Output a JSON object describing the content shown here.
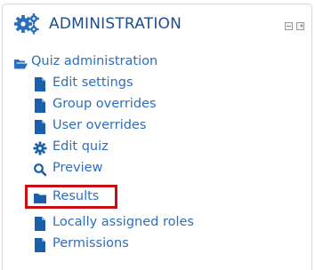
{
  "block": {
    "title": "ADMINISTRATION",
    "header_icon": "gears-icon",
    "controls": {
      "minimize_icon": "minimize-icon",
      "dock_icon": "dock-icon"
    }
  },
  "tree": {
    "root": {
      "label": "Quiz administration",
      "icon": "folder-open-icon"
    },
    "items": [
      {
        "label": "Edit settings",
        "icon": "file-icon"
      },
      {
        "label": "Group overrides",
        "icon": "file-icon"
      },
      {
        "label": "User overrides",
        "icon": "file-icon"
      },
      {
        "label": "Edit quiz",
        "icon": "gear-icon"
      },
      {
        "label": "Preview",
        "icon": "search-icon"
      },
      {
        "label": "Results",
        "icon": "folder-icon",
        "highlighted": true
      },
      {
        "label": "Locally assigned roles",
        "icon": "file-icon"
      },
      {
        "label": "Permissions",
        "icon": "file-icon"
      }
    ]
  },
  "colors": {
    "link": "#2c6fbe",
    "icon": "#1a5fa8",
    "title": "#1f4e8a",
    "highlight_border": "#c80f16"
  }
}
